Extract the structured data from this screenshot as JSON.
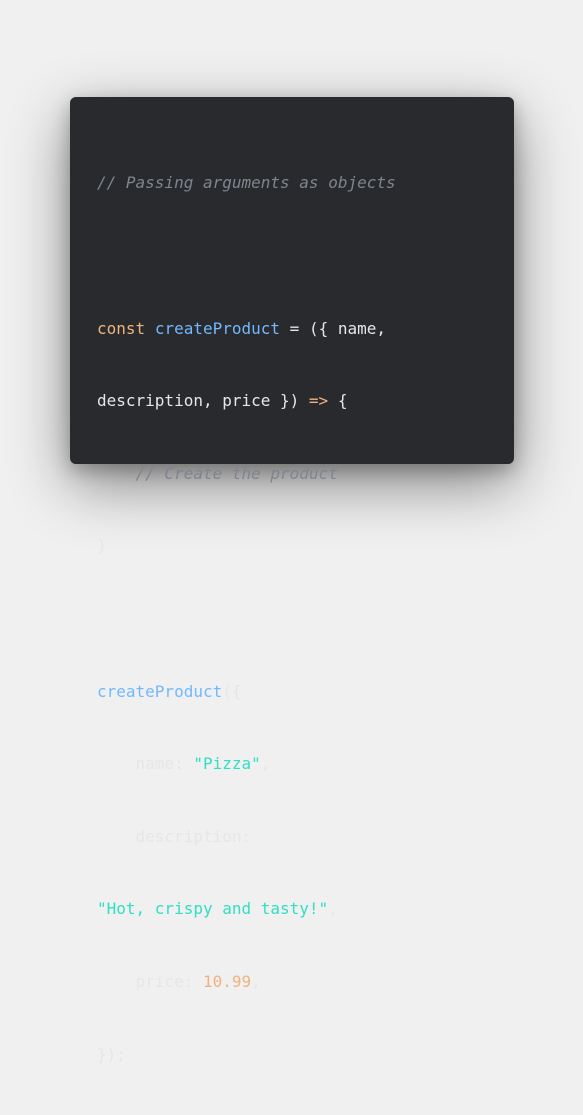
{
  "colors": {
    "background": "#f0f0f0",
    "card": "#282a2e",
    "comment": "#7f848e",
    "keyword": "#f0b37e",
    "function": "#73b8ff",
    "string": "#2fe0c4",
    "number": "#f0b37e",
    "text": "#e6e6e6"
  },
  "code": {
    "comment_header": "// Passing arguments as objects",
    "line_const_kw": "const",
    "line_const_fn": "createProduct",
    "line_const_rest": " = ({ name,",
    "line_params": "description, price }) ",
    "line_arrow": "=>",
    "line_brace_open": " {",
    "comment_inner": "    // Create the product",
    "line_brace_close": "}",
    "call_fn": "createProduct",
    "call_open": "({",
    "name_key": "    name: ",
    "name_val": "\"Pizza\"",
    "name_comma": ",",
    "desc_key": "    description:",
    "desc_val": "\"Hot, crispy and tasty!\"",
    "desc_comma": ",",
    "price_key": "    price: ",
    "price_val": "10.99",
    "price_comma": ",",
    "call_close": "});"
  }
}
